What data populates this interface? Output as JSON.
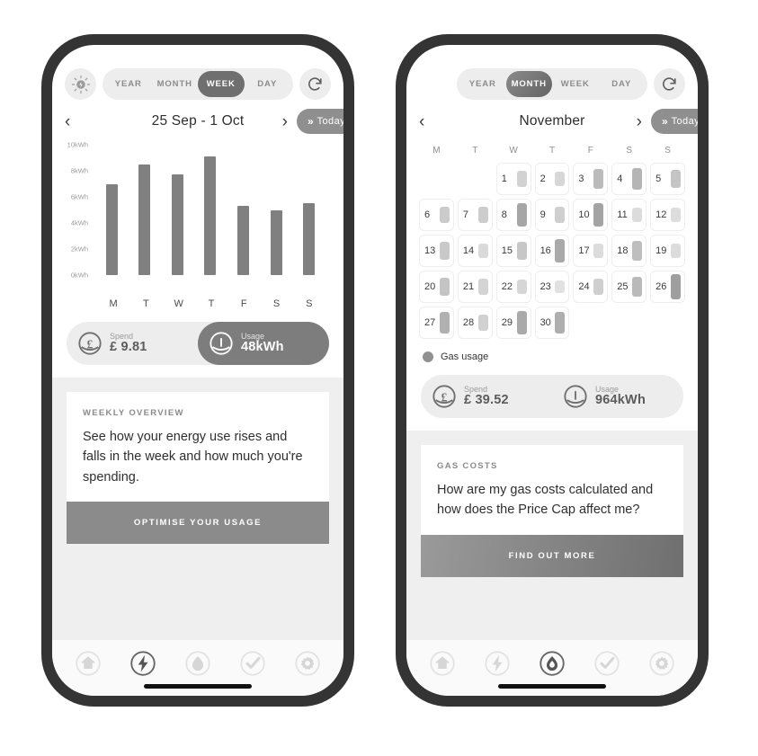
{
  "meta": {
    "background": "#ffffff",
    "bezel_color": "#343434",
    "accent_dark": "#6f6f6f",
    "accent_light": "#ededed",
    "bar_color": "#808080"
  },
  "phones": [
    {
      "id": "electricity-week",
      "topbar": {
        "leading_icon": "sun-bolt-icon",
        "has_leading_icon": true,
        "segments": [
          {
            "label": "YEAR",
            "active": false
          },
          {
            "label": "MONTH",
            "active": false
          },
          {
            "label": "WEEK",
            "active": true
          },
          {
            "label": "DAY",
            "active": false
          }
        ],
        "refresh_icon": "refresh-icon"
      },
      "daterow": {
        "prev_icon": "chevron-left-icon",
        "next_icon": "chevron-right-icon",
        "title": "25 Sep - 1 Oct",
        "today_label": "Today",
        "today_icon": "double-chevron-right-icon"
      },
      "pills": [
        {
          "icon": "pound-icon",
          "caption": "Spend",
          "value": "£ 9.81",
          "active": false
        },
        {
          "icon": "gauge-icon",
          "caption": "Usage",
          "value": "48kWh",
          "active": true
        }
      ],
      "card": {
        "kicker": "WEEKLY OVERVIEW",
        "text": "See how your energy use rises and falls in the week and how much you're spending.",
        "cta": "OPTIMISE YOUR USAGE",
        "cta_gradient": false
      },
      "nav": [
        {
          "icon": "home-icon",
          "active": false
        },
        {
          "icon": "electricity-icon",
          "active": true
        },
        {
          "icon": "gas-icon",
          "active": false
        },
        {
          "icon": "check-icon",
          "active": false
        },
        {
          "icon": "settings-icon",
          "active": false
        }
      ]
    },
    {
      "id": "gas-month",
      "topbar": {
        "leading_icon": "none",
        "has_leading_icon": false,
        "segments": [
          {
            "label": "YEAR",
            "active": false
          },
          {
            "label": "MONTH",
            "active": true
          },
          {
            "label": "WEEK",
            "active": false
          },
          {
            "label": "DAY",
            "active": false
          }
        ],
        "refresh_icon": "refresh-icon"
      },
      "daterow": {
        "prev_icon": "chevron-left-icon",
        "next_icon": "chevron-right-icon",
        "title": "November",
        "today_label": "Today",
        "today_icon": "double-chevron-right-icon"
      },
      "legend": {
        "label": "Gas usage",
        "color": "#919191"
      },
      "pills": [
        {
          "icon": "pound-icon",
          "caption": "Spend",
          "value": "£ 39.52",
          "active": false
        },
        {
          "icon": "gauge-icon",
          "caption": "Usage",
          "value": "964kWh",
          "active": false
        }
      ],
      "card": {
        "kicker": "GAS COSTS",
        "text": "How are my gas costs calculated and how does the Price Cap affect me?",
        "cta": "FIND OUT MORE",
        "cta_gradient": true
      },
      "nav": [
        {
          "icon": "home-icon",
          "active": false
        },
        {
          "icon": "electricity-icon",
          "active": false
        },
        {
          "icon": "gas-icon",
          "active": true
        },
        {
          "icon": "check-icon",
          "active": false
        },
        {
          "icon": "settings-icon",
          "active": false
        }
      ]
    }
  ],
  "chart_data": {
    "type": "bar",
    "title": "25 Sep - 1 Oct",
    "xlabel": "",
    "ylabel": "kWh",
    "categories": [
      "M",
      "T",
      "W",
      "T",
      "F",
      "S",
      "S"
    ],
    "values": [
      7.0,
      8.5,
      7.7,
      9.1,
      5.3,
      5.0,
      5.5
    ],
    "ylim": [
      0,
      10
    ],
    "yticks": [
      0,
      2,
      4,
      6,
      8,
      10
    ],
    "ytick_labels": [
      "0kWh",
      "2kWh",
      "4kWh",
      "6kWh",
      "8kWh",
      "10kWh"
    ],
    "grid": false,
    "legend": "none",
    "series_color": "#808080",
    "unit": "kWh"
  },
  "calendar": {
    "type": "heatmap",
    "month": "November",
    "dow": [
      "M",
      "T",
      "W",
      "T",
      "F",
      "S",
      "S"
    ],
    "lead_blanks": 2,
    "max_intensity": 1.0,
    "days": [
      {
        "day": 1,
        "intensity": 0.3
      },
      {
        "day": 2,
        "intensity": 0.25
      },
      {
        "day": 3,
        "intensity": 0.55
      },
      {
        "day": 4,
        "intensity": 0.62
      },
      {
        "day": 5,
        "intensity": 0.45
      },
      {
        "day": 6,
        "intensity": 0.38
      },
      {
        "day": 7,
        "intensity": 0.36
      },
      {
        "day": 8,
        "intensity": 0.78
      },
      {
        "day": 9,
        "intensity": 0.34
      },
      {
        "day": 10,
        "intensity": 0.8
      },
      {
        "day": 11,
        "intensity": 0.2
      },
      {
        "day": 12,
        "intensity": 0.18
      },
      {
        "day": 13,
        "intensity": 0.4
      },
      {
        "day": 14,
        "intensity": 0.22
      },
      {
        "day": 15,
        "intensity": 0.42
      },
      {
        "day": 16,
        "intensity": 0.75
      },
      {
        "day": 17,
        "intensity": 0.2
      },
      {
        "day": 18,
        "intensity": 0.52
      },
      {
        "day": 19,
        "intensity": 0.2
      },
      {
        "day": 20,
        "intensity": 0.46
      },
      {
        "day": 21,
        "intensity": 0.28
      },
      {
        "day": 22,
        "intensity": 0.26
      },
      {
        "day": 23,
        "intensity": 0.14
      },
      {
        "day": 24,
        "intensity": 0.34
      },
      {
        "day": 25,
        "intensity": 0.56
      },
      {
        "day": 26,
        "intensity": 0.86
      },
      {
        "day": 27,
        "intensity": 0.66
      },
      {
        "day": 28,
        "intensity": 0.32
      },
      {
        "day": 29,
        "intensity": 0.74
      },
      {
        "day": 30,
        "intensity": 0.7
      }
    ]
  }
}
